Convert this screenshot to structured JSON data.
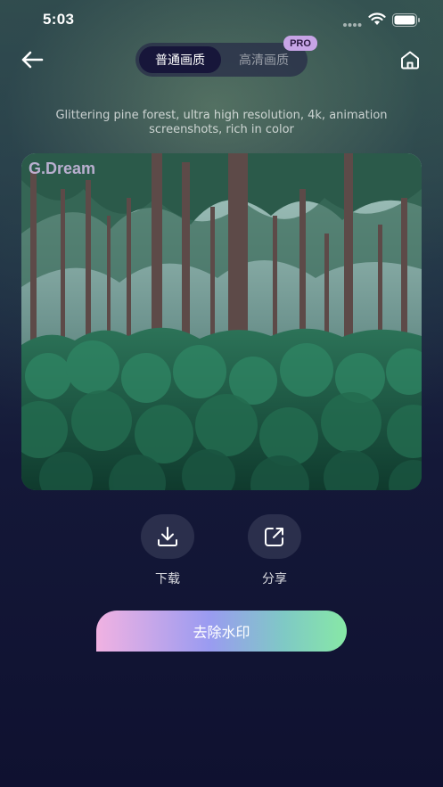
{
  "status": {
    "time": "5:03"
  },
  "header": {
    "back_icon": "arrow-left-icon",
    "home_icon": "home-icon",
    "tabs": [
      {
        "label": "普通画质",
        "active": true
      },
      {
        "label": "高清画质",
        "active": false
      }
    ],
    "pro_badge": "PRO"
  },
  "prompt": "Glittering pine forest, ultra high resolution, 4k, animation screenshots, rich in color",
  "image": {
    "watermark": "G.Dream"
  },
  "actions": [
    {
      "icon": "download-icon",
      "label": "下载"
    },
    {
      "icon": "share-icon",
      "label": "分享"
    }
  ],
  "remove_watermark": "去除水印",
  "colors": {
    "accent_gradient": [
      "#f1b2e2",
      "#9a9bf1",
      "#87e8a6"
    ],
    "pro_badge": "#c7a4e6",
    "background": "#0f1130"
  }
}
